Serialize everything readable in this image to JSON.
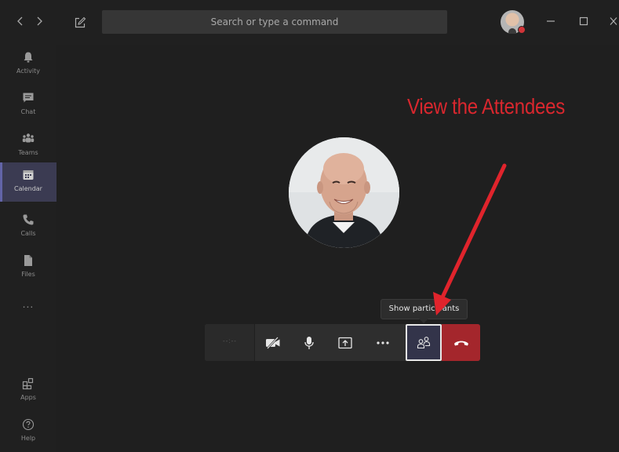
{
  "titlebar": {
    "search_placeholder": "Search or type a command",
    "icons": {
      "back": "chevron-left-icon",
      "forward": "chevron-right-icon",
      "compose": "compose-icon",
      "minimize": "minimize-icon",
      "maximize": "maximize-icon",
      "close": "close-icon"
    },
    "presence_color": "#d13438"
  },
  "sidebar": {
    "items": [
      {
        "label": "Activity",
        "icon": "bell-icon",
        "active": false
      },
      {
        "label": "Chat",
        "icon": "chat-icon",
        "active": false
      },
      {
        "label": "Teams",
        "icon": "teams-icon",
        "active": false
      },
      {
        "label": "Calendar",
        "icon": "calendar-icon",
        "active": true
      },
      {
        "label": "Calls",
        "icon": "phone-icon",
        "active": false
      },
      {
        "label": "Files",
        "icon": "file-icon",
        "active": false
      }
    ],
    "more_label": "...",
    "bottom_items": [
      {
        "label": "Apps",
        "icon": "apps-icon"
      },
      {
        "label": "Help",
        "icon": "help-icon"
      }
    ],
    "accent": "#6264a7"
  },
  "meeting": {
    "annotation_text": "View the Attendees",
    "annotation_color": "#d9272e",
    "tooltip": "Show participants",
    "controls": {
      "timer": "--:--",
      "camera": "camera-off-icon",
      "mic": "microphone-icon",
      "share": "share-screen-icon",
      "more": "more-options-icon",
      "participants": "participants-icon",
      "hangup": "hang-up-icon"
    },
    "hangup_color": "#a4262c"
  }
}
